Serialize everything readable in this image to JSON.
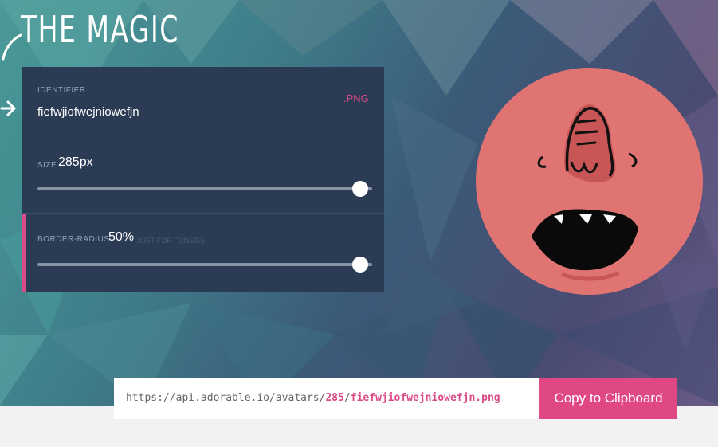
{
  "header": {
    "title": "THE MAGIC"
  },
  "form": {
    "identifier": {
      "label": "IDENTIFIER",
      "value": "fiefwjiofwejniowefjn",
      "extension": ".PNG"
    },
    "size": {
      "label": "SIZE",
      "value": "285px",
      "slider_level": 0.95
    },
    "border_radius": {
      "label": "BORDER-RADIUS",
      "value": "50%",
      "hint": "JUST FOR FUNSIES",
      "slider_level": 0.95
    }
  },
  "url": {
    "prefix": "https://api.adorable.io/avatars/",
    "size": "285",
    "slash": "/",
    "file": "fiefwjiofwejniowefjn.png"
  },
  "copy_button": {
    "label": "Copy to Clipboard"
  },
  "colors": {
    "accent": "#d94a86",
    "panel": "#2b3b54",
    "avatar_bg": "#e07472",
    "button": "#e04885"
  },
  "icons": [
    "hand-drawn-arrow-icon",
    "avatar-face"
  ]
}
